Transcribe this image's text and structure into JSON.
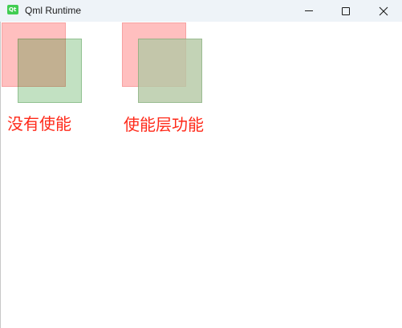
{
  "window": {
    "title": "Qml Runtime",
    "icon": "qt-logo-icon",
    "icon_glyph": "Qt",
    "controls": {
      "minimize": "minimize-icon",
      "maximize": "maximize-icon",
      "close": "close-icon"
    }
  },
  "demo": {
    "left_label": "没有使能",
    "right_label": "使能层功能",
    "colors": {
      "label": "#ff2a1a",
      "red_square": "#ffbfbf",
      "green_square": "#c3e0c3"
    }
  }
}
